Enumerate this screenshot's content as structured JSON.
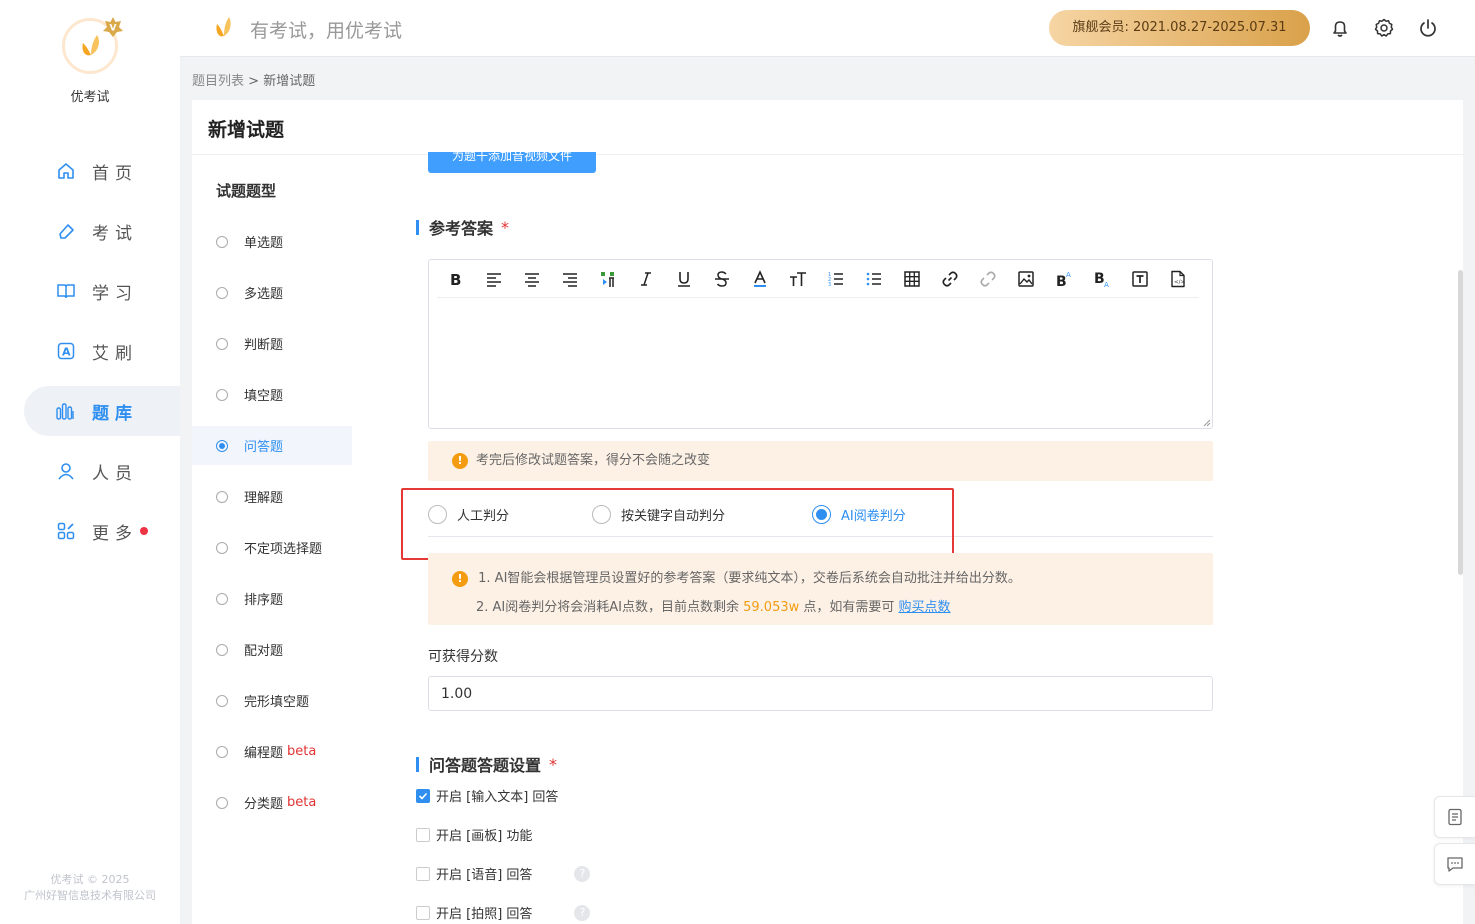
{
  "brand": {
    "name": "优考试",
    "slogan": "有考试，用优考试",
    "copyright": "优考试 © 2025",
    "company": "广州好智信息技术有限公司"
  },
  "nav": [
    {
      "label": "首页",
      "icon": "home-icon"
    },
    {
      "label": "考试",
      "icon": "eraser-icon"
    },
    {
      "label": "学习",
      "icon": "book-icon"
    },
    {
      "label": "艾刷",
      "icon": "a-badge-icon"
    },
    {
      "label": "题库",
      "icon": "bar-chart-icon",
      "active": true
    },
    {
      "label": "人员",
      "icon": "user-icon"
    },
    {
      "label": "更多",
      "icon": "grid-icon",
      "dot": true
    }
  ],
  "header": {
    "member": "旗舰会员: 2021.08.27-2025.07.31"
  },
  "breadcrumb": {
    "parent": "题目列表",
    "sep": " > ",
    "current": "新增试题"
  },
  "page": {
    "title": "新增试题"
  },
  "types": {
    "title": "试题题型",
    "items": [
      {
        "label": "单选题"
      },
      {
        "label": "多选题"
      },
      {
        "label": "判断题"
      },
      {
        "label": "填空题"
      },
      {
        "label": "问答题",
        "active": true
      },
      {
        "label": "理解题"
      },
      {
        "label": "不定项选择题"
      },
      {
        "label": "排序题"
      },
      {
        "label": "配对题"
      },
      {
        "label": "完形填空题"
      },
      {
        "label": "编程题",
        "beta": "beta"
      },
      {
        "label": "分类题",
        "beta": "beta"
      }
    ]
  },
  "upload_button": "为题干添加音视频文件",
  "answer": {
    "title": "参考答案",
    "required": "*",
    "toolbar": [
      "bold-icon",
      "align-left-icon",
      "align-center-icon",
      "align-right-icon",
      "paragraph-icon",
      "italic-icon",
      "underline-icon",
      "strikethrough-icon",
      "font-color-icon",
      "font-size-icon",
      "ordered-list-icon",
      "unordered-list-icon",
      "table-icon",
      "link-icon",
      "unlink-icon",
      "image-icon",
      "superscript-icon",
      "subscript-icon",
      "text-box-icon",
      "html-file-icon"
    ],
    "notice": "考完后修改试题答案，得分不会随之改变"
  },
  "grading": {
    "options": [
      {
        "label": "人工判分"
      },
      {
        "label": "按关键字自动判分"
      },
      {
        "label": "AI阅卷判分",
        "active": true
      }
    ],
    "notice_line1": "1. AI智能会根据管理员设置好的参考答案（要求纯文本），交卷后系统会自动批注并给出分数。",
    "notice_line2_pre": "2. AI阅卷判分将会消耗AI点数，目前点数剩余 ",
    "points": "59.053w",
    "notice_line2_post": " 点，如有需要可 ",
    "buy_link": "购买点数"
  },
  "score": {
    "label": "可获得分数",
    "value": "1.00"
  },
  "answer_settings": {
    "title": "问答题答题设置",
    "required": "*",
    "items": [
      {
        "label": "开启 [输入文本] 回答",
        "checked": true
      },
      {
        "label": "开启 [画板] 功能",
        "checked": false
      },
      {
        "label": "开启 [语音] 回答",
        "checked": false,
        "help": "?"
      },
      {
        "label": "开启 [拍照] 回答",
        "checked": false,
        "help": "?"
      }
    ]
  },
  "colors": {
    "primary": "#2f8ff0",
    "warning": "#f39c12",
    "danger": "#e23333",
    "notice_bg": "#fdf1e6"
  }
}
